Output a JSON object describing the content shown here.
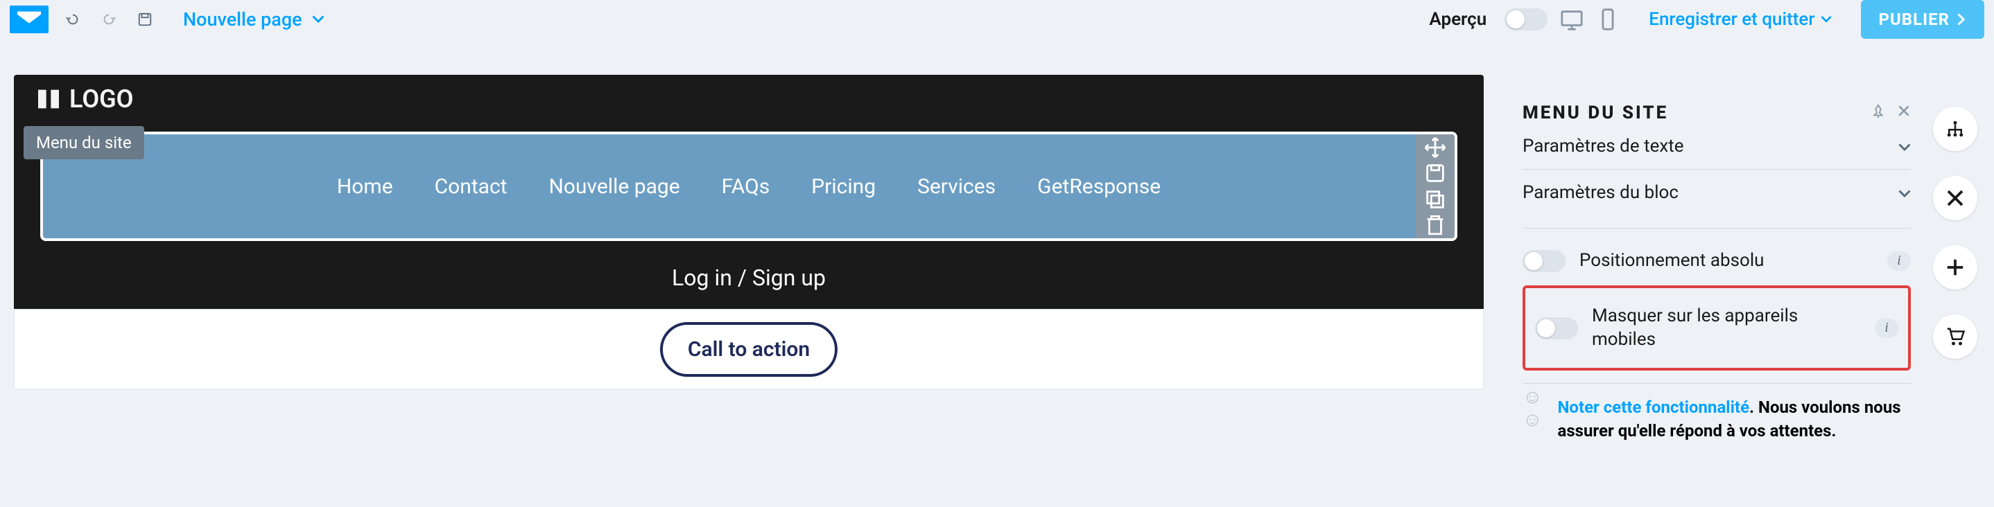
{
  "topbar": {
    "new_page_label": "Nouvelle page",
    "preview_label": "Aperçu",
    "save_exit_label": "Enregistrer et quitter",
    "publish_label": "PUBLIER"
  },
  "stage": {
    "brand_label": "LOGO",
    "tooltip": "Menu du site",
    "nav_items": [
      "Home",
      "Contact",
      "Nouvelle page",
      "FAQs",
      "Pricing",
      "Services",
      "GetResponse"
    ],
    "login_label": "Log in / Sign up",
    "cta_label": "Call to action"
  },
  "side_panel": {
    "title": "MENU DU SITE",
    "section_text": "Paramètres de texte",
    "section_block": "Paramètres du bloc",
    "absolute_pos": "Positionnement absolu",
    "hide_mobile": "Masquer sur les appareils mobiles",
    "rate_link": "Noter cette fonctionnalité",
    "rate_text_1": ". Nous voulons nous assurer qu'elle répond à vos attentes."
  }
}
